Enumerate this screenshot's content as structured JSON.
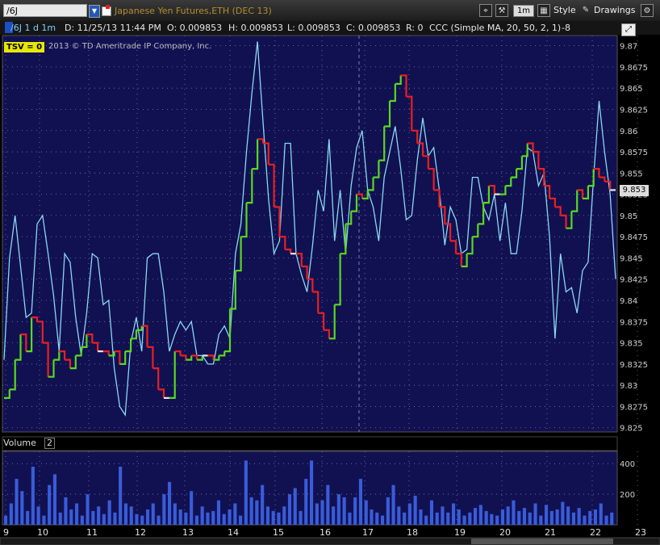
{
  "toolbar": {
    "symbol": "/6J",
    "description": "Japanese Yen Futures,ETH (DEC 13)",
    "timeframe": "1m",
    "style_label": "Style",
    "drawings_label": "Drawings"
  },
  "info": {
    "symbol_period": "/6J 1 d 1m",
    "date": "D: 11/25/13 11:44 PM",
    "open": "O: 0.009853",
    "high": "H: 0.009853",
    "low": "L: 0.009853",
    "close": "C: 0.009853",
    "range": "R: 0",
    "study": "CCC (Simple MA, 20, 50, 2, 1)",
    "study_value": "-8"
  },
  "tsv_label": "TSV",
  "tsv_value": "0",
  "copyright": "2013 © TD Ameritrade IP Company, Inc.",
  "last_price": "9.853",
  "volume_label": "Volume",
  "volume_count": "2",
  "colors": {
    "background": "#111152",
    "grid": "#7a7aa8",
    "up": "#5ad81e",
    "down": "#e82020",
    "neutral": "#e8e8e8",
    "indicator": "#8ad8f0",
    "volume": "#3a5cd8"
  },
  "chart_data": [
    {
      "type": "line",
      "title": "/6J 1 d 1m",
      "y_axis_ticks": [
        "9.87",
        "9.8675",
        "9.865",
        "9.8625",
        "9.86",
        "9.8575",
        "9.855",
        "9.8525",
        "9.85",
        "9.8475",
        "9.845",
        "9.8425",
        "9.84",
        "9.8375",
        "9.835",
        "9.8325",
        "9.83",
        "9.8275",
        "9.825"
      ],
      "ylim": [
        9.8245,
        9.8712
      ],
      "x_axis_ticks": [
        "9",
        "10",
        "11",
        "12",
        "13",
        "14",
        "15",
        "16",
        "17",
        "18",
        "19",
        "20",
        "21",
        "22",
        "23"
      ],
      "series": [
        {
          "kind": "price",
          "values": [
            9.8285,
            9.8295,
            9.833,
            9.836,
            9.834,
            9.838,
            9.8375,
            9.835,
            9.831,
            9.833,
            9.834,
            9.833,
            9.832,
            9.8335,
            9.8345,
            9.836,
            9.835,
            9.834,
            9.834,
            9.8335,
            9.834,
            9.8325,
            9.834,
            9.8355,
            9.8365,
            9.837,
            9.8345,
            9.832,
            9.8295,
            9.8285,
            9.8285,
            9.834,
            9.8335,
            9.833,
            9.8335,
            9.833,
            9.8335,
            9.8335,
            9.833,
            9.8335,
            9.834,
            9.839,
            9.8435,
            9.8475,
            9.8515,
            9.8555,
            9.859,
            9.8585,
            9.856,
            9.851,
            9.8475,
            9.846,
            9.8455,
            9.8455,
            9.844,
            9.8425,
            9.841,
            9.8385,
            9.8365,
            9.8355,
            9.8395,
            9.8455,
            9.849,
            9.8505,
            9.8525,
            9.852,
            9.853,
            9.8545,
            9.8565,
            9.8605,
            9.8635,
            9.8655,
            9.8665,
            9.864,
            9.86,
            9.8585,
            9.857,
            9.8555,
            9.853,
            9.851,
            9.849,
            9.847,
            9.8455,
            9.844,
            9.8455,
            9.8475,
            9.849,
            9.8515,
            9.8535,
            9.8525,
            9.8525,
            9.8535,
            9.8545,
            9.8555,
            9.857,
            9.8585,
            9.8575,
            9.8555,
            9.8535,
            9.852,
            9.851,
            9.85,
            9.8485,
            9.8505,
            9.853,
            9.852,
            9.8535,
            9.8555,
            9.8545,
            9.854,
            9.853,
            9.853
          ]
        },
        {
          "kind": "indicator",
          "values": [
            9.833,
            9.845,
            9.85,
            9.844,
            9.838,
            9.8385,
            9.849,
            9.85,
            9.8455,
            9.8405,
            9.834,
            9.8455,
            9.8445,
            9.838,
            9.8335,
            9.8385,
            9.8455,
            9.845,
            9.8395,
            9.84,
            9.832,
            9.8275,
            9.8265,
            9.835,
            9.838,
            9.834,
            9.845,
            9.8455,
            9.8455,
            9.841,
            9.834,
            9.836,
            9.8375,
            9.8365,
            9.8375,
            9.8335,
            9.8335,
            9.8325,
            9.8325,
            9.836,
            9.837,
            9.8355,
            9.8455,
            9.849,
            9.8575,
            9.8645,
            9.8705,
            9.861,
            9.852,
            9.8455,
            9.847,
            9.8585,
            9.8585,
            9.8455,
            9.843,
            9.841,
            9.8465,
            9.853,
            9.8505,
            9.859,
            9.847,
            9.853,
            9.8455,
            9.8535,
            9.858,
            9.86,
            9.853,
            9.851,
            9.847,
            9.8545,
            9.8575,
            9.8605,
            9.8555,
            9.8495,
            9.85,
            9.8565,
            9.8615,
            9.857,
            9.858,
            9.853,
            9.8465,
            9.851,
            9.8495,
            9.8455,
            9.846,
            9.8545,
            9.8545,
            9.851,
            9.8495,
            9.8525,
            9.847,
            9.8515,
            9.8455,
            9.8455,
            9.8505,
            9.858,
            9.8575,
            9.8535,
            9.855,
            9.8475,
            9.8355,
            9.8455,
            9.841,
            9.8415,
            9.8385,
            9.8435,
            9.8445,
            9.8545,
            9.8635,
            9.8575,
            9.8525,
            9.8425
          ]
        },
        {
          "kind": "volume",
          "y_axis_ticks": [
            "400",
            "200"
          ],
          "ylim": [
            0,
            480
          ],
          "values": [
            60,
            140,
            300,
            220,
            90,
            380,
            120,
            60,
            260,
            330,
            80,
            180,
            100,
            140,
            60,
            200,
            90,
            120,
            70,
            160,
            80,
            380,
            140,
            120,
            70,
            60,
            100,
            140,
            60,
            200,
            280,
            140,
            100,
            80,
            220,
            60,
            120,
            80,
            90,
            160,
            70,
            100,
            140,
            60,
            420,
            180,
            160,
            260,
            120,
            90,
            80,
            120,
            200,
            240,
            90,
            300,
            420,
            140,
            160,
            260,
            120,
            200,
            180,
            80,
            180,
            300,
            160,
            100,
            80,
            60,
            180,
            260,
            120,
            80,
            140,
            190,
            100,
            60,
            160,
            80,
            120,
            80,
            140,
            100,
            60,
            80,
            110,
            130,
            90,
            70,
            60,
            100,
            120,
            160,
            90,
            110,
            80,
            140,
            60,
            130,
            90,
            100,
            150,
            120,
            80,
            110,
            60,
            90,
            100,
            140,
            60,
            80
          ]
        }
      ]
    }
  ]
}
